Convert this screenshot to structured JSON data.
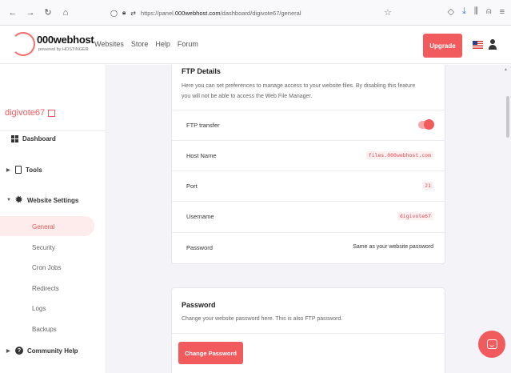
{
  "browser": {
    "url_prefix": "https://panel.",
    "url_host": "000webhost.com",
    "url_path": "/dashboard/digivote67/general"
  },
  "header": {
    "logo_text": "000webhost",
    "logo_sub": "powered by HOSTINGER",
    "nav": [
      "Websites",
      "Store",
      "Help",
      "Forum"
    ],
    "upgrade_label": "Upgrade"
  },
  "sidebar": {
    "site_name": "digivote67",
    "items": {
      "dashboard": "Dashboard",
      "tools": "Tools",
      "website_settings": "Website Settings",
      "community_help": "Community Help"
    },
    "sub_items": [
      "General",
      "Security",
      "Cron Jobs",
      "Redirects",
      "Logs",
      "Backups"
    ]
  },
  "ftp": {
    "title": "FTP Details",
    "description": "Here you can set preferences to manage access to your website files. By disabling this feature you will not be able to access the Web File Manager.",
    "rows": {
      "transfer_label": "FTP transfer",
      "host_label": "Host Name",
      "host_value": "files.000webhost.com",
      "port_label": "Port",
      "port_value": "21",
      "username_label": "Username",
      "username_value": "digivote67",
      "password_label": "Password",
      "password_value": "Same as your website password"
    }
  },
  "password": {
    "title": "Password",
    "description": "Change your website password here. This is also FTP password.",
    "button_label": "Change Password"
  },
  "colors": {
    "accent": "#f15b5e",
    "background": "#f4f4f8"
  }
}
